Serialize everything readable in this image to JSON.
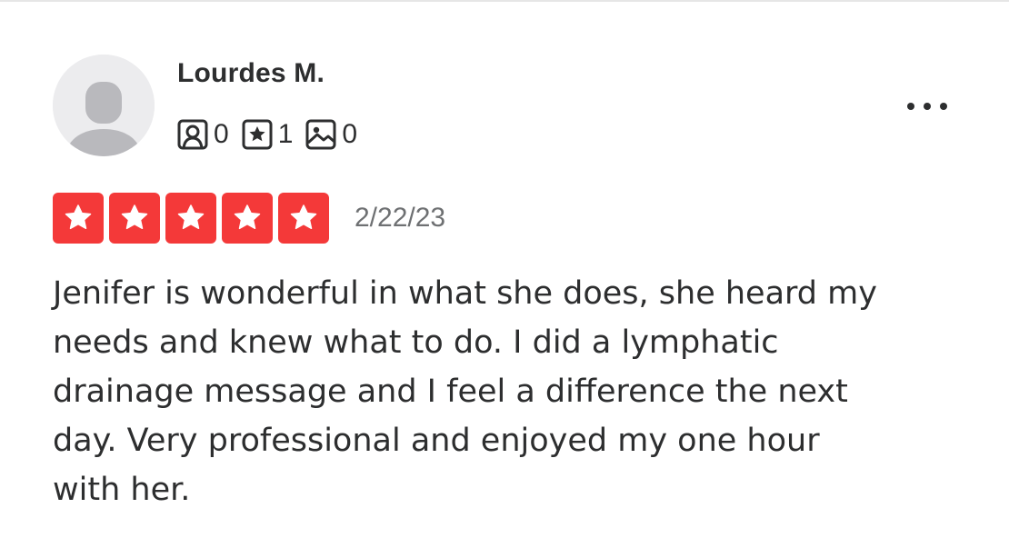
{
  "review": {
    "user": {
      "name": "Lourdes M.",
      "avatar_icon": "default-user-avatar-icon",
      "stats": [
        {
          "icon": "friends-icon",
          "value": "0"
        },
        {
          "icon": "reviews-star-icon",
          "value": "1"
        },
        {
          "icon": "photos-icon",
          "value": "0"
        }
      ]
    },
    "more_icon": "more-options-icon",
    "rating": {
      "value": 5,
      "max": 5,
      "color": "#f43939"
    },
    "date": "2/22/23",
    "text": "Jenifer is wonderful in what she does, she heard my\nneeds and knew what to do.  I did a lymphatic\ndrainage message and I feel a difference the next\nday.  Very professional and enjoyed my one hour\nwith her."
  }
}
